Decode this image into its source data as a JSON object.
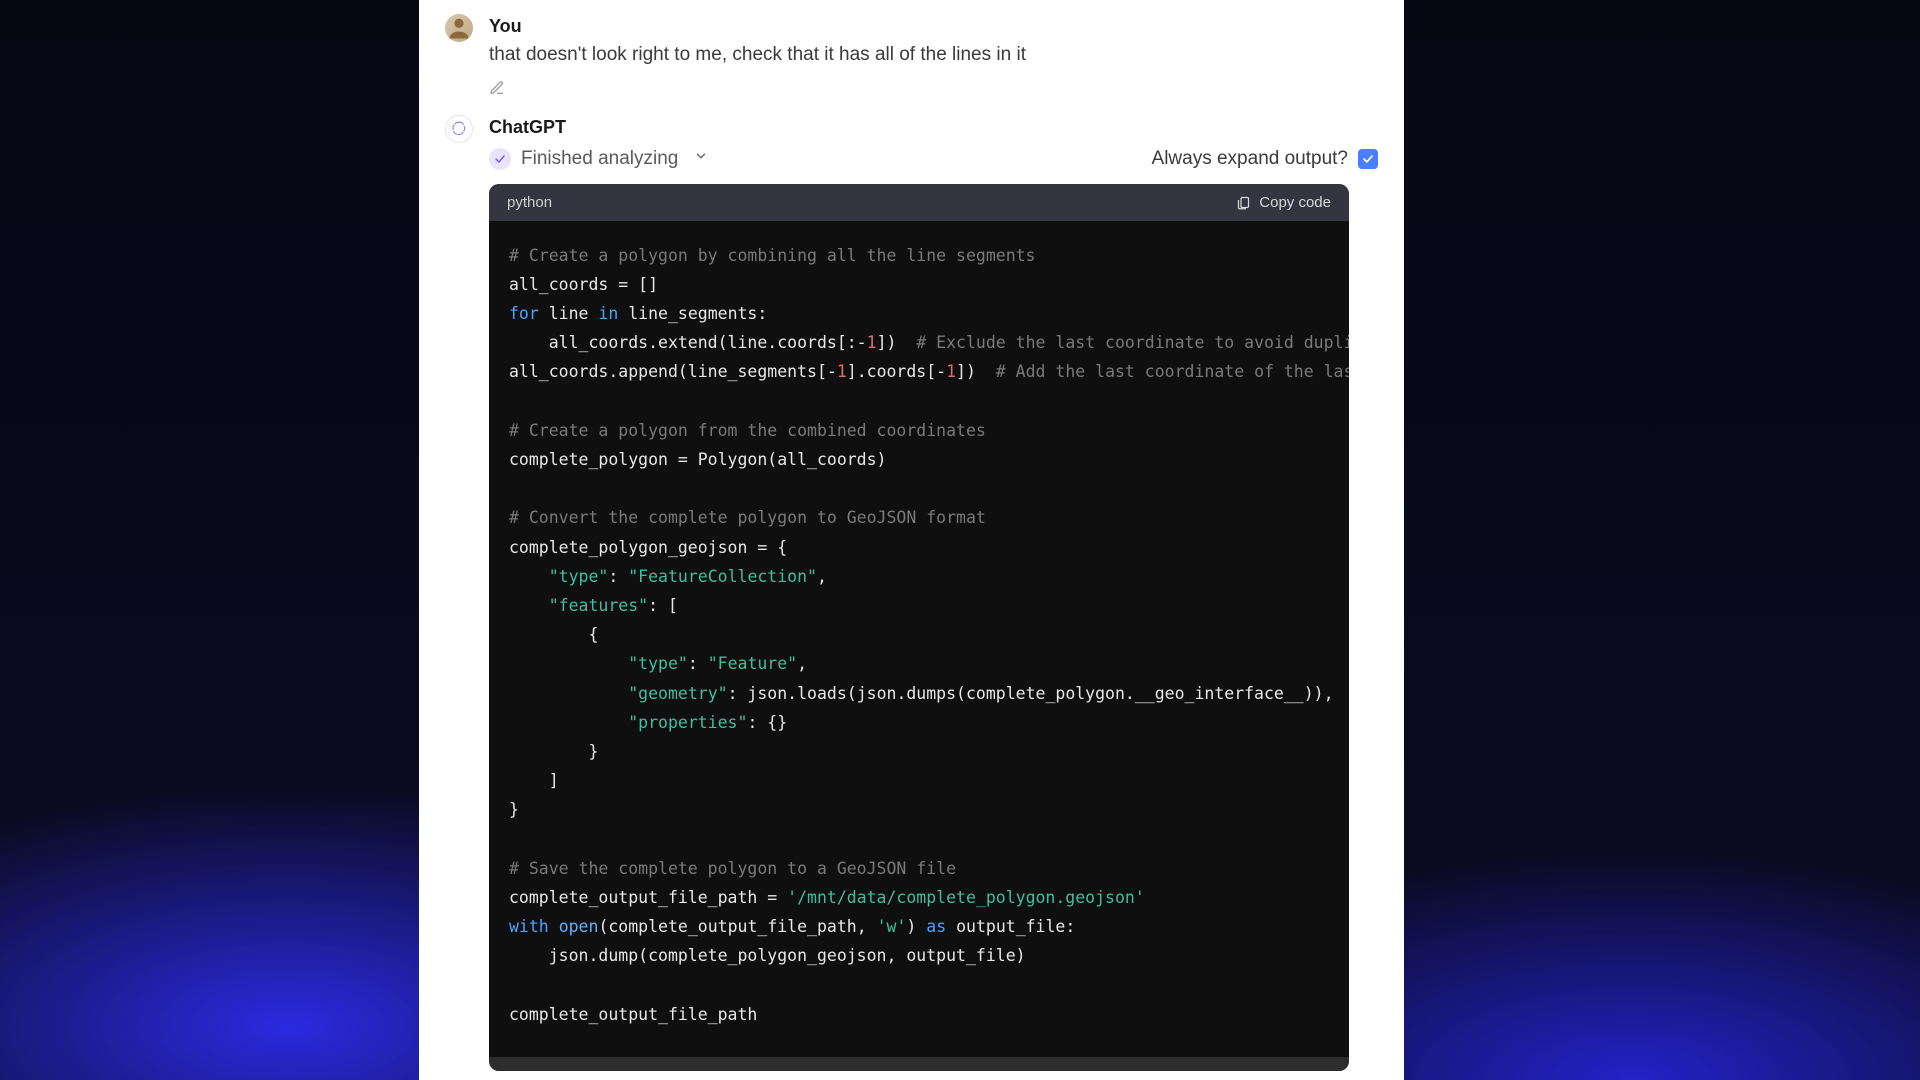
{
  "user": {
    "author": "You",
    "text": "that doesn't look right to me, check that it has all of the lines in it"
  },
  "assistant": {
    "author": "ChatGPT",
    "status": "Finished analyzing",
    "expand_label": "Always expand output?",
    "expand_checked": true,
    "code_lang": "python",
    "copy_label": "Copy code",
    "code": {
      "c1": "# Create a polygon by combining all the line segments",
      "l2": "all_coords = []",
      "l3a": "for",
      "l3b": " line ",
      "l3c": "in",
      "l3d": " line_segments:",
      "l4a": "    all_coords.extend(line.coords[:-",
      "l4num": "1",
      "l4b": "])  ",
      "l4c": "# Exclude the last coordinate to avoid dupli",
      "l5a": "all_coords.append(line_segments[-",
      "l5num1": "1",
      "l5b": "].coords[-",
      "l5num2": "1",
      "l5c": "])  ",
      "l5d": "# Add the last coordinate of the las",
      "c2": "# Create a polygon from the combined coordinates",
      "l7": "complete_polygon = Polygon(all_coords)",
      "c3": "# Convert the complete polygon to GeoJSON format",
      "l9": "complete_polygon_geojson = {",
      "l10a": "    ",
      "l10s1": "\"type\"",
      "l10b": ": ",
      "l10s2": "\"FeatureCollection\"",
      "l10c": ",",
      "l11a": "    ",
      "l11s": "\"features\"",
      "l11b": ": [",
      "l12": "        {",
      "l13a": "            ",
      "l13s1": "\"type\"",
      "l13b": ": ",
      "l13s2": "\"Feature\"",
      "l13c": ",",
      "l14a": "            ",
      "l14s": "\"geometry\"",
      "l14b": ": json.loads(json.dumps(complete_polygon.__geo_interface__)),",
      "l15a": "            ",
      "l15s": "\"properties\"",
      "l15b": ": {}",
      "l16": "        }",
      "l17": "    ]",
      "l18": "}",
      "c4": "# Save the complete polygon to a GeoJSON file",
      "l20a": "complete_output_file_path = ",
      "l20s": "'/mnt/data/complete_polygon.geojson'",
      "l21a": "with",
      "l21b": " ",
      "l21c": "open",
      "l21d": "(complete_output_file_path, ",
      "l21s": "'w'",
      "l21e": ") ",
      "l21f": "as",
      "l21g": " output_file:",
      "l22": "    json.dump(complete_polygon_geojson, output_file)",
      "l23": "complete_output_file_path"
    }
  }
}
